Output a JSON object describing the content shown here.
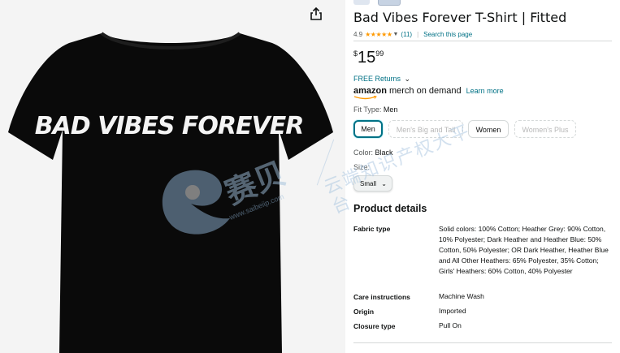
{
  "colors": {
    "link": "#007185",
    "star": "#ff9900",
    "text": "#0f1111",
    "muted": "#565959",
    "shirt": "#0a0a0a",
    "image_bg": "#f4f4f4"
  },
  "product_image": {
    "share_icon": "share-icon",
    "shirt_print": "BAD VIBES FOREVER"
  },
  "watermark": {
    "brand": "赛贝",
    "url": "www.saibeiip.com",
    "slogan": "云端知识产权大平台"
  },
  "product": {
    "title": "Bad Vibes Forever T-Shirt | Fitted",
    "rating_value": "4.9",
    "rating_stars": "★★★★★",
    "review_count": "(11)",
    "search_link": "Search this page",
    "price": {
      "symbol": "$",
      "whole": "15",
      "fraction": "99"
    },
    "free_returns": "FREE Returns",
    "merch_brand": "amazon",
    "merch_text": "merch on demand",
    "learn_more": "Learn more"
  },
  "fit_type": {
    "label": "Fit Type:",
    "selected": "Men",
    "options": [
      "Men",
      "Men's Big and Tall",
      "Women",
      "Women's Plus"
    ]
  },
  "color": {
    "label": "Color:",
    "value": "Black"
  },
  "size": {
    "label": "Size:",
    "value": "Small"
  },
  "product_details": {
    "title": "Product details",
    "rows": [
      {
        "key": "Fabric type",
        "value": "Solid colors: 100% Cotton; Heather Grey: 90% Cotton, 10% Polyester; Dark Heather and Heather Blue: 50% Cotton, 50% Polyester; OR Dark Heather, Heather Blue and All Other Heathers: 65% Polyester, 35% Cotton; Girls' Heathers: 60% Cotton, 40% Polyester"
      },
      {
        "key": "Care instructions",
        "value": "Machine Wash"
      },
      {
        "key": "Origin",
        "value": "Imported"
      },
      {
        "key": "Closure type",
        "value": "Pull On"
      }
    ]
  }
}
